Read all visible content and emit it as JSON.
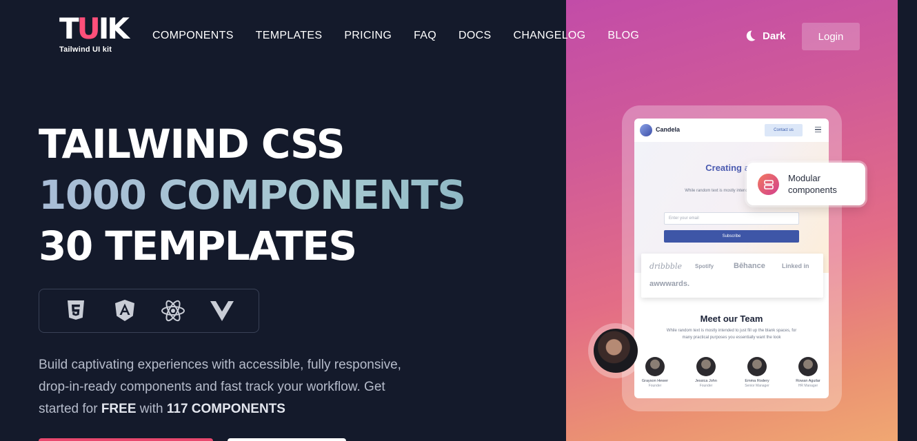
{
  "nav": {
    "logo_text": "TUIK",
    "logo_subtitle": "Tailwind UI kit",
    "items": [
      "COMPONENTS",
      "TEMPLATES",
      "PRICING",
      "FAQ",
      "DOCS",
      "CHANGELOG",
      "BLOG"
    ],
    "theme_label": "Dark",
    "login_label": "Login"
  },
  "hero": {
    "title_line1": "TAILWIND CSS",
    "title_line2": "1000 COMPONENTS",
    "title_line3": "30 TEMPLATES",
    "tech_icons": [
      "html5-icon",
      "angular-icon",
      "react-icon",
      "vue-icon"
    ],
    "description_pre": "Build captivating experiences with accessible, fully responsive, drop-in-ready components and fast track your workflow. Get started for ",
    "description_free": "FREE",
    "description_mid": " with ",
    "description_count": "117 COMPONENTS"
  },
  "mockup": {
    "brand": "Candela",
    "contact_label": "Contact us",
    "heading": "Creating a g workspa",
    "subtext": "While random text is mostly intende spaces",
    "email_placeholder": "Enter your email",
    "subscribe_label": "Subscribe",
    "logos": [
      "dribbble",
      "Spotify",
      "Bēhance",
      "Linked in",
      "awwwards."
    ],
    "team_title": "Meet our Team",
    "team_desc": "While random text is mostly intended to just fill up the blank spaces, for many practical purposes you essentially want the look",
    "members": [
      {
        "name": "Grayson Hewer",
        "role": "Founder"
      },
      {
        "name": "Jessica John",
        "role": "Founder"
      },
      {
        "name": "Emma Rodery",
        "role": "Senior Manager"
      },
      {
        "name": "Rowan Aguilar",
        "role": "HR Manager"
      }
    ]
  },
  "feature_card": {
    "label": "Modular components",
    "icon": "stack-icon"
  },
  "colors": {
    "background": "#141a2b",
    "accent": "#e9486e",
    "panel_gradient_start": "#c24ca8",
    "panel_gradient_end": "#f0a772"
  }
}
